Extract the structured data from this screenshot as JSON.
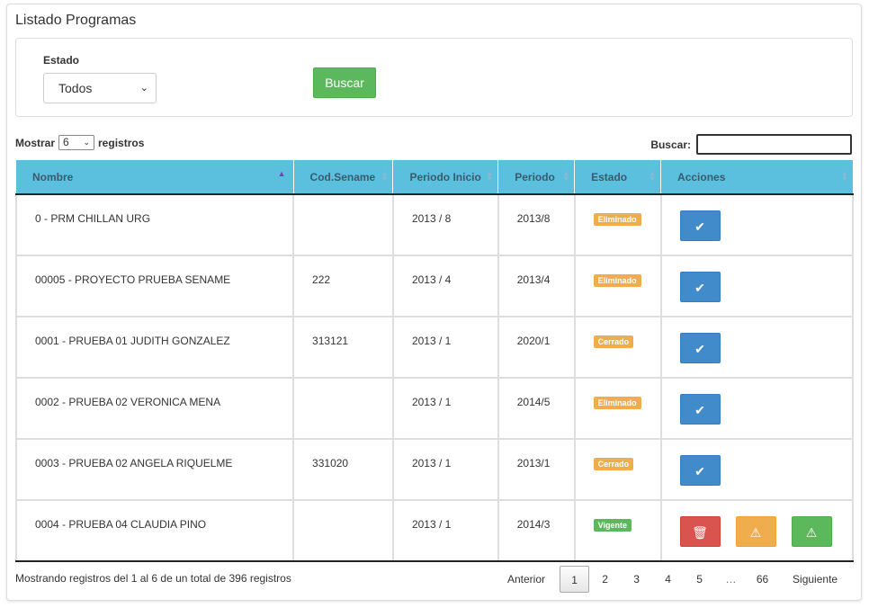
{
  "panel": {
    "title": "Listado Programas"
  },
  "filter": {
    "estado_label": "Estado",
    "estado_value": "Todos",
    "buscar_button": "Buscar"
  },
  "length": {
    "prefix": "Mostrar",
    "value": "6",
    "suffix": "registros"
  },
  "search": {
    "label": "Buscar:",
    "value": ""
  },
  "table": {
    "columns": [
      "Nombre",
      "Cod.Sename",
      "Periodo Inicio",
      "Periodo",
      "Estado",
      "Acciones"
    ],
    "rows": [
      {
        "nombre": "0 - PRM CHILLAN URG",
        "cod": "",
        "inicio": "2013 / 8",
        "periodo": "2013/8",
        "estado": "Eliminado"
      },
      {
        "nombre": "00005 - PROYECTO PRUEBA SENAME",
        "cod": "222",
        "inicio": "2013 / 4",
        "periodo": "2013/4",
        "estado": "Eliminado"
      },
      {
        "nombre": "0001 - PRUEBA 01 JUDITH GONZALEZ",
        "cod": "313121",
        "inicio": "2013 / 1",
        "periodo": "2020/1",
        "estado": "Cerrado"
      },
      {
        "nombre": "0002 - PRUEBA 02 VERONICA MENA",
        "cod": "",
        "inicio": "2013 / 1",
        "periodo": "2014/5",
        "estado": "Eliminado"
      },
      {
        "nombre": "0003 - PRUEBA 02 ANGELA RIQUELME",
        "cod": "331020",
        "inicio": "2013 / 1",
        "periodo": "2013/1",
        "estado": "Cerrado"
      },
      {
        "nombre": "0004 - PRUEBA 04 CLAUDIA PINO",
        "cod": "",
        "inicio": "2013 / 1",
        "periodo": "2014/3",
        "estado": "Vigente"
      }
    ]
  },
  "icons": {
    "sort": "sort-arrows-icon",
    "check": "check-icon",
    "trash": "trash-icon",
    "warning": "warning-icon"
  },
  "colors": {
    "header": "#5bc0de",
    "primary": "#428bca",
    "success": "#5cb85c",
    "warning": "#f0ad4e",
    "danger": "#d9534f"
  },
  "info": "Mostrando registros del 1 al 6 de un total de 396 registros",
  "pager": {
    "prev": "Anterior",
    "pages": [
      "1",
      "2",
      "3",
      "4",
      "5"
    ],
    "ellipsis": "…",
    "last": "66",
    "next": "Siguiente"
  }
}
